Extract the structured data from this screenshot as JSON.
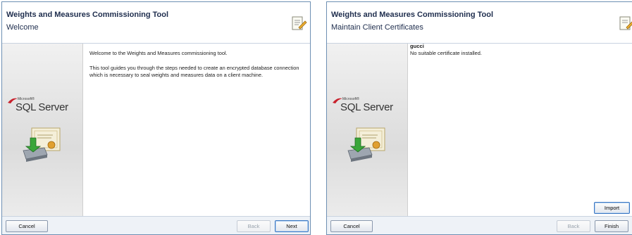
{
  "left": {
    "title": "Weights and Measures Commissioning Tool",
    "subtitle": "Welcome",
    "logo_small": "Microsoft®",
    "logo_big": "SQL Server",
    "paragraphs": [
      "Welcome to the Weights and Measures commissioning tool.",
      "This tool guides you through the steps needed to create an encrypted database connection which is necessary to seal weights and measures data on a client machine."
    ],
    "buttons": {
      "cancel": "Cancel",
      "back": "Back",
      "next": "Next"
    }
  },
  "right": {
    "title": "Weights and Measures Commissioning Tool",
    "subtitle": "Maintain Client Certificates",
    "logo_small": "Microsoft®",
    "logo_big": "SQL Server",
    "client_name": "gucci",
    "client_status": "No suitable certificate installed.",
    "buttons": {
      "import": "Import",
      "cancel": "Cancel",
      "back": "Back",
      "finish": "Finish"
    }
  },
  "colors": {
    "title": "#1e2d4d",
    "frame": "#6d8fb3",
    "footer": "#eef2f7",
    "accent_red": "#c8202b"
  },
  "icons": [
    "wizard-edit-icon",
    "sql-server-logo",
    "certificate-install-icon"
  ]
}
